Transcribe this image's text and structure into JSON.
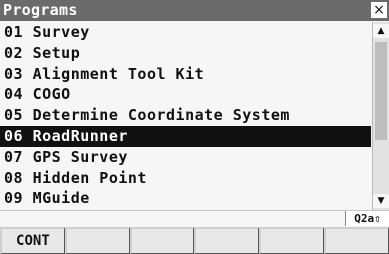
{
  "window": {
    "title": "Programs",
    "close_glyph": "×"
  },
  "programs": [
    "01 Survey",
    "02 Setup",
    "03 Alignment Tool Kit",
    "04 COGO",
    "05 Determine Coordinate System",
    "06 RoadRunner",
    "07 GPS Survey",
    "08 Hidden Point",
    "09 MGuide"
  ],
  "selected_index": 5,
  "status": {
    "input_mode": "Q2a⇧"
  },
  "fkeys": [
    "CONT",
    "",
    "",
    "",
    "",
    ""
  ],
  "icons": {
    "scroll_up": "up-arrow-icon",
    "scroll_down": "down-arrow-icon",
    "close": "close-icon"
  }
}
